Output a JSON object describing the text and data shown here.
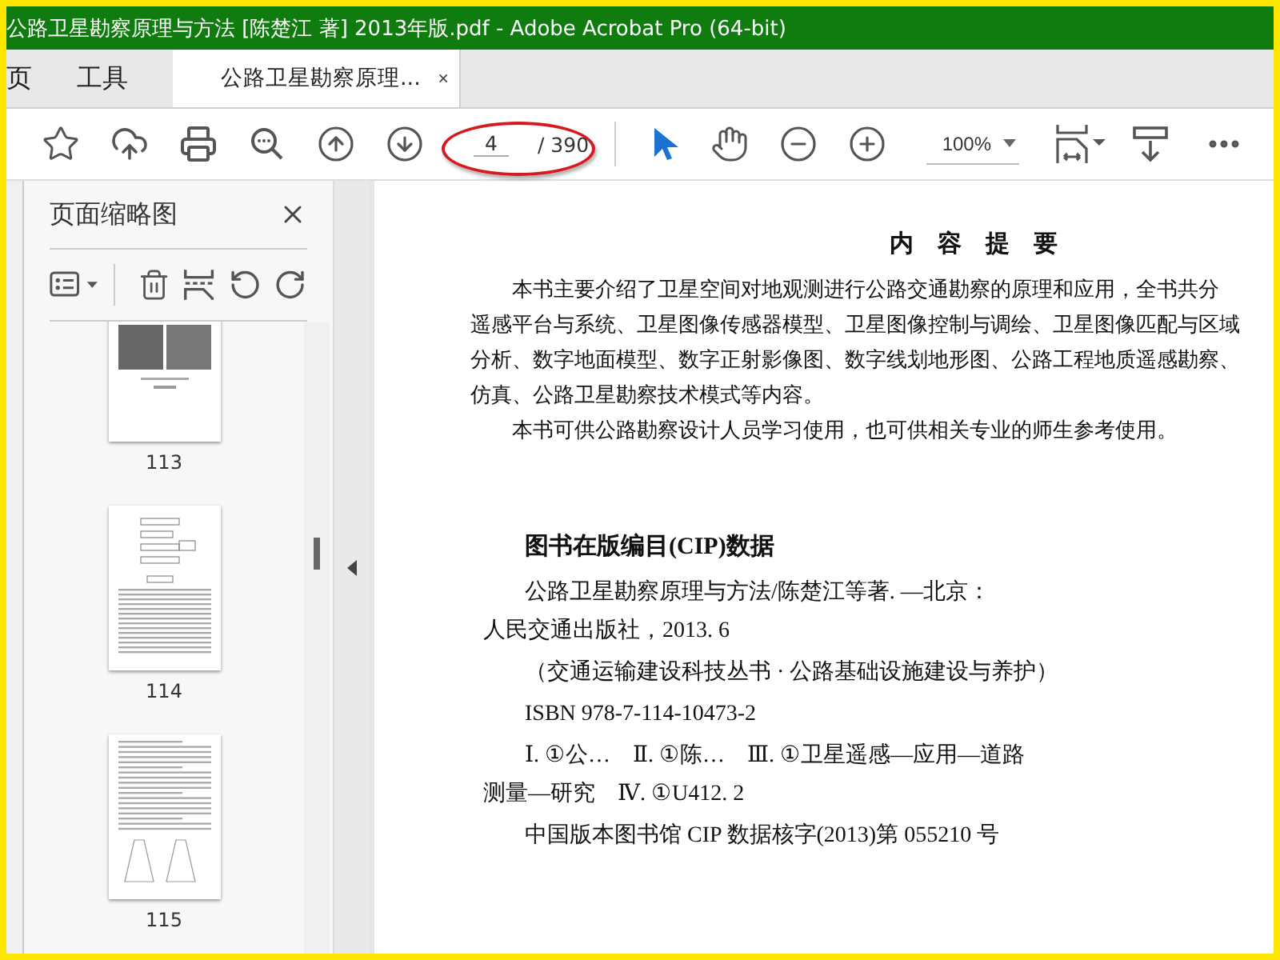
{
  "window": {
    "title": "公路卫星勘察原理与方法 [陈楚江 著] 2013年版.pdf - Adobe Acrobat Pro (64-bit)"
  },
  "tabs": [
    {
      "label": "页",
      "selected": false,
      "kind": "nav"
    },
    {
      "label": "工具",
      "selected": false,
      "kind": "nav"
    },
    {
      "label": "公路卫星勘察原理...",
      "selected": true,
      "kind": "document"
    }
  ],
  "toolbar": {
    "page_current": "4",
    "page_total": "/ 390",
    "zoom": "100%",
    "tools": [
      {
        "kind": "select",
        "selected": true
      },
      {
        "kind": "hand",
        "selected": false
      }
    ]
  },
  "sidebar": {
    "title": "页面缩略图",
    "thumbnails": [
      {
        "label": "113",
        "kind": "photos"
      },
      {
        "label": "114",
        "kind": "flowchart"
      },
      {
        "label": "115",
        "kind": "figure"
      }
    ]
  },
  "document": {
    "heading": "内　容　提　要",
    "paragraphs": [
      [
        "本书主要介绍了卫星空间对地观测进行公路交通勘察的原理和应用，全书共分",
        "遥感平台与系统、卫星图像传感器模型、卫星图像控制与调绘、卫星图像匹配与区域",
        "分析、数字地面模型、数字正射影像图、数字线划地形图、公路工程地质遥感勘察、",
        "仿真、公路卫星勘察技术模式等内容。"
      ],
      [
        "本书可供公路勘察设计人员学习使用，也可供相关专业的师生参考使用。"
      ]
    ],
    "cip_heading": "图书在版编目(CIP)数据",
    "cip_paragraphs": [
      [
        "公路卫星勘察原理与方法/陈楚江等著. —北京：",
        "人民交通出版社，2013. 6"
      ],
      [
        "（交通运输建设科技丛书 · 公路基础设施建设与养护）"
      ],
      [
        "ISBN  978-7-114-10473-2"
      ],
      [
        "Ⅰ. ①公…　Ⅱ. ①陈…　Ⅲ. ①卫星遥感—应用—道路",
        "测量—研究　Ⅳ. ①U412. 2"
      ],
      [
        "中国版本图书馆 CIP 数据核字(2013)第 055210 号"
      ]
    ]
  }
}
